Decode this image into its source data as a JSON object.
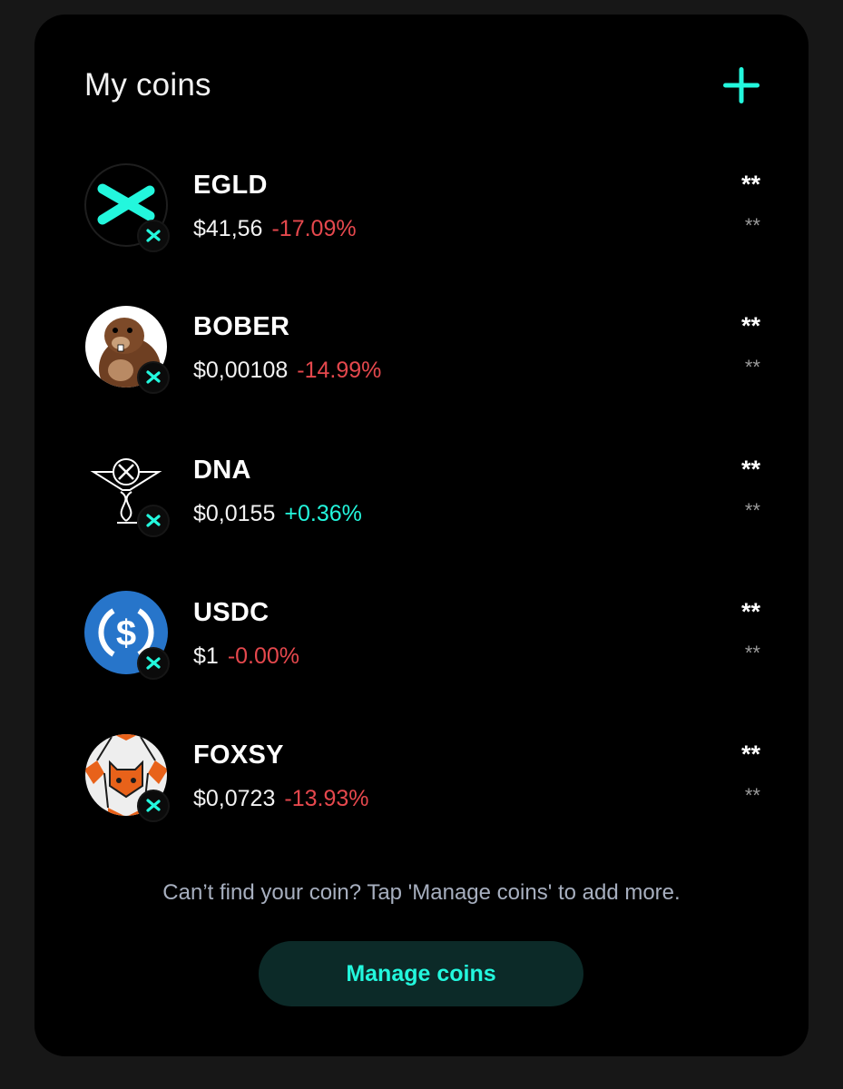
{
  "header": {
    "title": "My coins",
    "add_icon": "plus-icon"
  },
  "colors": {
    "accent": "#23f7dd",
    "negative": "#e5484d",
    "card_background": "#000000",
    "page_background": "#171717",
    "button_background": "#0c2a28"
  },
  "coins": [
    {
      "symbol": "EGLD",
      "price": "$41,56",
      "change": "-17.09%",
      "direction": "down",
      "balance": "**",
      "value": "**",
      "logo_icon": "egld-logo-icon",
      "chain_icon": "multiversx-chain-icon"
    },
    {
      "symbol": "BOBER",
      "price": "$0,00108",
      "change": "-14.99%",
      "direction": "down",
      "balance": "**",
      "value": "**",
      "logo_icon": "bober-beaver-logo-icon",
      "chain_icon": "multiversx-chain-icon"
    },
    {
      "symbol": "DNA",
      "price": "$0,0155",
      "change": "+0.36%",
      "direction": "up",
      "balance": "**",
      "value": "**",
      "logo_icon": "dna-logo-icon",
      "chain_icon": "multiversx-chain-icon"
    },
    {
      "symbol": "USDC",
      "price": "$1",
      "change": "-0.00%",
      "direction": "down",
      "balance": "**",
      "value": "**",
      "logo_icon": "usdc-logo-icon",
      "chain_icon": "multiversx-chain-icon"
    },
    {
      "symbol": "FOXSY",
      "price": "$0,0723",
      "change": "-13.93%",
      "direction": "down",
      "balance": "**",
      "value": "**",
      "logo_icon": "foxsy-logo-icon",
      "chain_icon": "multiversx-chain-icon"
    }
  ],
  "footer": {
    "hint": "Can’t find your coin? Tap 'Manage coins' to add more.",
    "manage_button_label": "Manage coins"
  }
}
